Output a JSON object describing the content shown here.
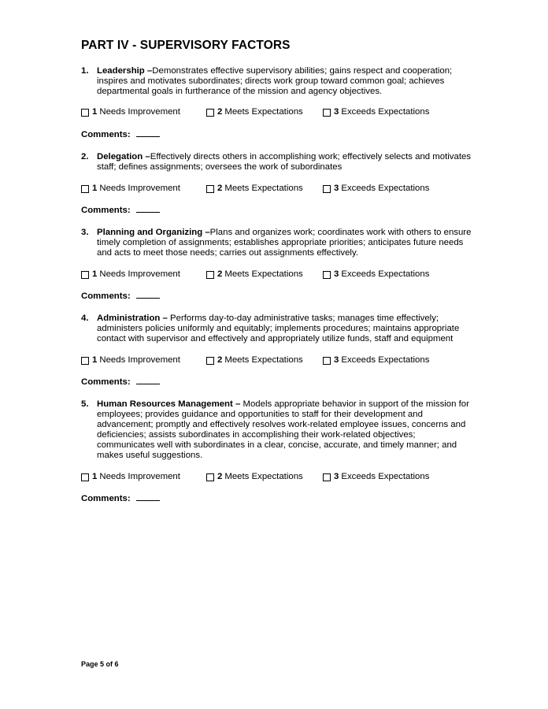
{
  "document": {
    "title": "PART IV - SUPERVISORY FACTORS",
    "rating_options": [
      {
        "number": "1",
        "label": "Needs Improvement"
      },
      {
        "number": "2",
        "label": "Meets Expectations"
      },
      {
        "number": "3",
        "label": "Exceeds Expectations"
      }
    ],
    "comments_label": "Comments:",
    "factors": [
      {
        "number": "1.",
        "heading": "Leadership –",
        "description": "Demonstrates effective supervisory abilities; gains respect and cooperation; inspires and motivates subordinates; directs work group toward common goal; achieves departmental goals in furtherance of the mission and agency objectives."
      },
      {
        "number": "2.",
        "heading": "Delegation –",
        "description": "Effectively directs others in accomplishing work; effectively selects and motivates staff; defines assignments; oversees the work of subordinates"
      },
      {
        "number": "3.",
        "heading": "Planning and Organizing –",
        "description": "Plans and organizes work; coordinates work with others to ensure timely completion of assignments; establishes appropriate priorities; anticipates future needs and acts to meet those needs; carries out assignments effectively."
      },
      {
        "number": "4.",
        "heading": "Administration – ",
        "description": "Performs day-to-day administrative tasks; manages time effectively; administers policies uniformly and equitably; implements procedures; maintains appropriate contact with supervisor and effectively and appropriately utilize funds, staff and equipment"
      },
      {
        "number": "5.",
        "heading": "Human Resources Management – ",
        "description": "Models appropriate behavior in support of the mission for employees; provides guidance and opportunities to staff for their development and advancement; promptly and effectively resolves work-related employee issues, concerns and deficiencies; assists subordinates in accomplishing their work-related objectives; communicates well with subordinates in a clear, concise, accurate, and timely manner; and makes useful suggestions."
      }
    ],
    "footer": "Page 5 of 6"
  }
}
